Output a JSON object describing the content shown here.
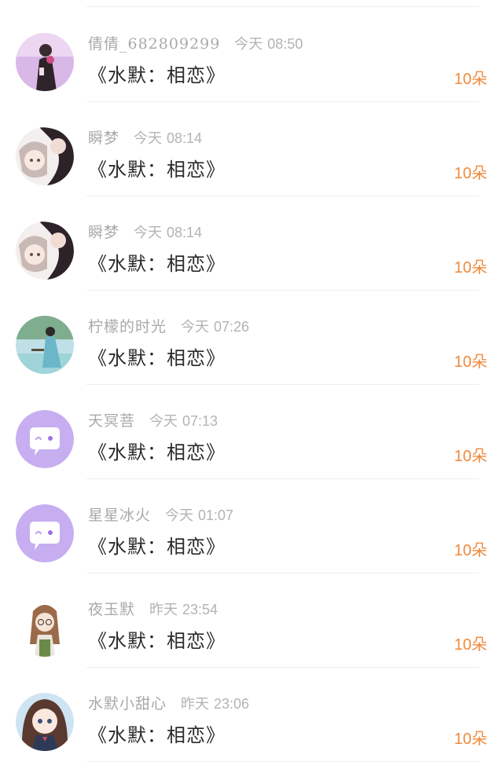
{
  "gift_records": [
    {
      "user": "倩倩_682809299",
      "day": "今天",
      "time": "08:50",
      "title": "《水默：相恋》",
      "amount": "10",
      "unit": "朵",
      "avatar": "photo-girl-purple"
    },
    {
      "user": "瞬梦",
      "day": "今天",
      "time": "08:14",
      "title": "《水默：相恋》",
      "amount": "10",
      "unit": "朵",
      "avatar": "anime-couple"
    },
    {
      "user": "瞬梦",
      "day": "今天",
      "time": "08:14",
      "title": "《水默：相恋》",
      "amount": "10",
      "unit": "朵",
      "avatar": "anime-couple"
    },
    {
      "user": "柠檬的时光",
      "day": "今天",
      "time": "07:26",
      "title": "《水默：相恋》",
      "amount": "10",
      "unit": "朵",
      "avatar": "costume-scene"
    },
    {
      "user": "天冥菩",
      "day": "今天",
      "time": "07:13",
      "title": "《水默：相恋》",
      "amount": "10",
      "unit": "朵",
      "avatar": "default-chat-bubble"
    },
    {
      "user": "星星冰火",
      "day": "今天",
      "time": "01:07",
      "title": "《水默：相恋》",
      "amount": "10",
      "unit": "朵",
      "avatar": "default-chat-bubble"
    },
    {
      "user": "夜玉默",
      "day": "昨天",
      "time": "23:54",
      "title": "《水默：相恋》",
      "amount": "10",
      "unit": "朵",
      "avatar": "girl-glasses"
    },
    {
      "user": "水默小甜心",
      "day": "昨天",
      "time": "23:06",
      "title": "《水默：相恋》",
      "amount": "10",
      "unit": "朵",
      "avatar": "anime-girl-uniform"
    }
  ],
  "colors": {
    "accent": "#f08a3c",
    "default_avatar": "#c6aef0"
  }
}
